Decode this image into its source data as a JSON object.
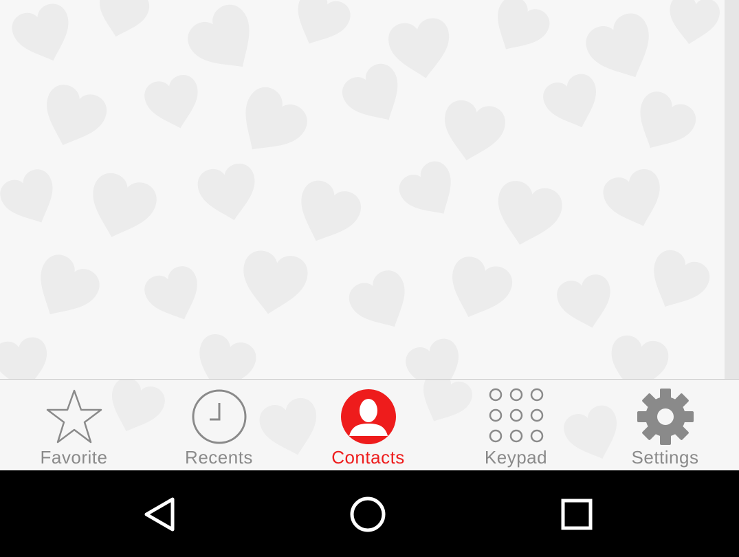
{
  "tabs": [
    {
      "id": "favorite",
      "label": "Favorite",
      "icon": "star-icon",
      "active": false
    },
    {
      "id": "recents",
      "label": "Recents",
      "icon": "clock-icon",
      "active": false
    },
    {
      "id": "contacts",
      "label": "Contacts",
      "icon": "person-icon",
      "active": true
    },
    {
      "id": "keypad",
      "label": "Keypad",
      "icon": "keypad-icon",
      "active": false
    },
    {
      "id": "settings",
      "label": "Settings",
      "icon": "gear-icon",
      "active": false
    }
  ],
  "navigation": {
    "back_icon": "back-triangle-icon",
    "home_icon": "home-circle-icon",
    "recents_icon": "overview-square-icon"
  },
  "colors": {
    "accent": "#ee1c1c",
    "inactive": "#8a8a8a",
    "background": "#f7f7f7",
    "nav_bar": "#000000"
  }
}
